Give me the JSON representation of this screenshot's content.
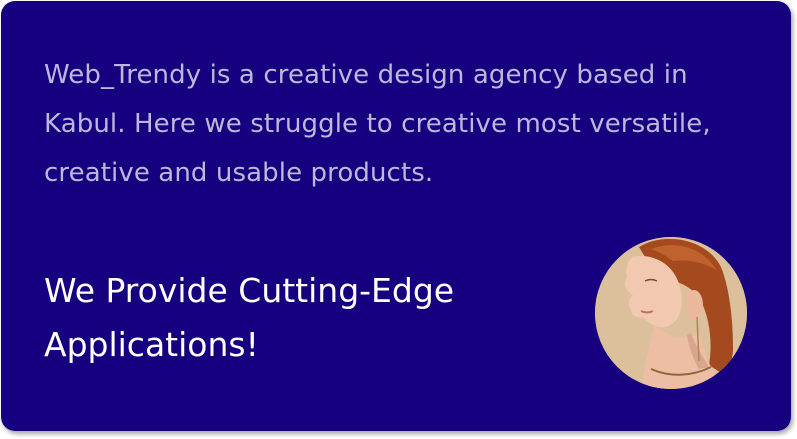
{
  "intro": {
    "text": "Web_Trendy is a creative design agency based in Kabul. Here we struggle to creative most versatile, creative and usable products."
  },
  "headline": {
    "text": "We Provide Cutting-Edge Applications!"
  },
  "avatar": {
    "icon": "portrait-photo",
    "alt": "Woman with red hair"
  },
  "colors": {
    "card_background": "#17007f",
    "intro_text": "#bdb7dc",
    "headline_text": "#ffffff",
    "avatar_background": "#d9bf9a"
  }
}
